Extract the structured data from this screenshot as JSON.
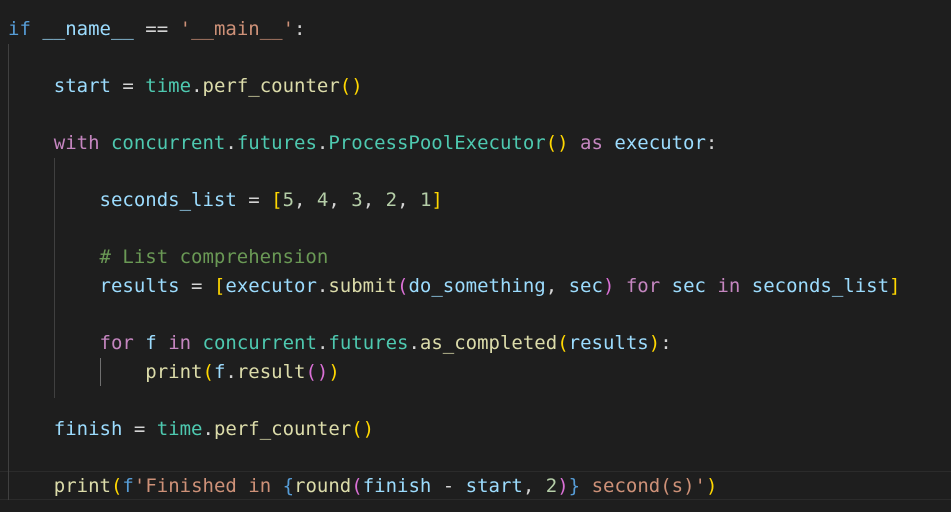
{
  "editor": {
    "language": "python",
    "theme_colors": {
      "background": "#1e1e1e",
      "keyword_control": "#c586c0",
      "keyword_storage": "#569cd6",
      "variable": "#9cdcfe",
      "function": "#dcdcaa",
      "class": "#4ec9b0",
      "string": "#ce9178",
      "number": "#b5cea8",
      "comment": "#6a9955",
      "bracket_level1": "#ffd700",
      "bracket_level2": "#da70d6",
      "bracket_level3": "#179fff",
      "operator": "#d4d4d4"
    },
    "lines": [
      {
        "tokens": [
          {
            "t": "if",
            "c": "keyword_storage"
          },
          {
            "t": " ",
            "c": "operator"
          },
          {
            "t": "__name__",
            "c": "variable"
          },
          {
            "t": " == ",
            "c": "operator"
          },
          {
            "t": "'__main__'",
            "c": "string"
          },
          {
            "t": ":",
            "c": "operator"
          }
        ]
      },
      {
        "tokens": []
      },
      {
        "tokens": [
          {
            "t": "    ",
            "c": "operator"
          },
          {
            "t": "start",
            "c": "variable"
          },
          {
            "t": " = ",
            "c": "operator"
          },
          {
            "t": "time",
            "c": "class"
          },
          {
            "t": ".",
            "c": "operator"
          },
          {
            "t": "perf_counter",
            "c": "function"
          },
          {
            "t": "()",
            "c": "bracket_level1"
          }
        ]
      },
      {
        "tokens": []
      },
      {
        "tokens": [
          {
            "t": "    ",
            "c": "operator"
          },
          {
            "t": "with",
            "c": "keyword_control"
          },
          {
            "t": " ",
            "c": "operator"
          },
          {
            "t": "concurrent",
            "c": "class"
          },
          {
            "t": ".",
            "c": "operator"
          },
          {
            "t": "futures",
            "c": "class"
          },
          {
            "t": ".",
            "c": "operator"
          },
          {
            "t": "ProcessPoolExecutor",
            "c": "class"
          },
          {
            "t": "()",
            "c": "bracket_level1"
          },
          {
            "t": " ",
            "c": "operator"
          },
          {
            "t": "as",
            "c": "keyword_control"
          },
          {
            "t": " ",
            "c": "operator"
          },
          {
            "t": "executor",
            "c": "variable"
          },
          {
            "t": ":",
            "c": "operator"
          }
        ]
      },
      {
        "tokens": []
      },
      {
        "tokens": [
          {
            "t": "        ",
            "c": "operator"
          },
          {
            "t": "seconds_list",
            "c": "variable"
          },
          {
            "t": " = ",
            "c": "operator"
          },
          {
            "t": "[",
            "c": "bracket_level1"
          },
          {
            "t": "5",
            "c": "number"
          },
          {
            "t": ", ",
            "c": "operator"
          },
          {
            "t": "4",
            "c": "number"
          },
          {
            "t": ", ",
            "c": "operator"
          },
          {
            "t": "3",
            "c": "number"
          },
          {
            "t": ", ",
            "c": "operator"
          },
          {
            "t": "2",
            "c": "number"
          },
          {
            "t": ", ",
            "c": "operator"
          },
          {
            "t": "1",
            "c": "number"
          },
          {
            "t": "]",
            "c": "bracket_level1"
          }
        ]
      },
      {
        "tokens": []
      },
      {
        "tokens": [
          {
            "t": "        ",
            "c": "operator"
          },
          {
            "t": "# List comprehension",
            "c": "comment"
          }
        ]
      },
      {
        "tokens": [
          {
            "t": "        ",
            "c": "operator"
          },
          {
            "t": "results",
            "c": "variable"
          },
          {
            "t": " = ",
            "c": "operator"
          },
          {
            "t": "[",
            "c": "bracket_level1"
          },
          {
            "t": "executor",
            "c": "variable"
          },
          {
            "t": ".",
            "c": "operator"
          },
          {
            "t": "submit",
            "c": "function"
          },
          {
            "t": "(",
            "c": "bracket_level2"
          },
          {
            "t": "do_something",
            "c": "variable"
          },
          {
            "t": ", ",
            "c": "operator"
          },
          {
            "t": "sec",
            "c": "variable"
          },
          {
            "t": ")",
            "c": "bracket_level2"
          },
          {
            "t": " ",
            "c": "operator"
          },
          {
            "t": "for",
            "c": "keyword_control"
          },
          {
            "t": " ",
            "c": "operator"
          },
          {
            "t": "sec",
            "c": "variable"
          },
          {
            "t": " ",
            "c": "operator"
          },
          {
            "t": "in",
            "c": "keyword_control"
          },
          {
            "t": " ",
            "c": "operator"
          },
          {
            "t": "seconds_list",
            "c": "variable"
          },
          {
            "t": "]",
            "c": "bracket_level1"
          }
        ]
      },
      {
        "tokens": []
      },
      {
        "tokens": [
          {
            "t": "        ",
            "c": "operator"
          },
          {
            "t": "for",
            "c": "keyword_control"
          },
          {
            "t": " ",
            "c": "operator"
          },
          {
            "t": "f",
            "c": "variable"
          },
          {
            "t": " ",
            "c": "operator"
          },
          {
            "t": "in",
            "c": "keyword_control"
          },
          {
            "t": " ",
            "c": "operator"
          },
          {
            "t": "concurrent",
            "c": "class"
          },
          {
            "t": ".",
            "c": "operator"
          },
          {
            "t": "futures",
            "c": "class"
          },
          {
            "t": ".",
            "c": "operator"
          },
          {
            "t": "as_completed",
            "c": "function"
          },
          {
            "t": "(",
            "c": "bracket_level1"
          },
          {
            "t": "results",
            "c": "variable"
          },
          {
            "t": ")",
            "c": "bracket_level1"
          },
          {
            "t": ":",
            "c": "operator"
          }
        ]
      },
      {
        "tokens": [
          {
            "t": "            ",
            "c": "operator"
          },
          {
            "t": "print",
            "c": "function"
          },
          {
            "t": "(",
            "c": "bracket_level1"
          },
          {
            "t": "f",
            "c": "variable"
          },
          {
            "t": ".",
            "c": "operator"
          },
          {
            "t": "result",
            "c": "function"
          },
          {
            "t": "()",
            "c": "bracket_level2"
          },
          {
            "t": ")",
            "c": "bracket_level1"
          }
        ]
      },
      {
        "tokens": []
      },
      {
        "tokens": [
          {
            "t": "    ",
            "c": "operator"
          },
          {
            "t": "finish",
            "c": "variable"
          },
          {
            "t": " = ",
            "c": "operator"
          },
          {
            "t": "time",
            "c": "class"
          },
          {
            "t": ".",
            "c": "operator"
          },
          {
            "t": "perf_counter",
            "c": "function"
          },
          {
            "t": "()",
            "c": "bracket_level1"
          }
        ]
      },
      {
        "tokens": []
      },
      {
        "tokens": [
          {
            "t": "    ",
            "c": "operator"
          },
          {
            "t": "print",
            "c": "function"
          },
          {
            "t": "(",
            "c": "bracket_level1"
          },
          {
            "t": "f",
            "c": "keyword_storage"
          },
          {
            "t": "'Finished in ",
            "c": "string"
          },
          {
            "t": "{",
            "c": "keyword_storage"
          },
          {
            "t": "round",
            "c": "function"
          },
          {
            "t": "(",
            "c": "bracket_level2"
          },
          {
            "t": "finish",
            "c": "variable"
          },
          {
            "t": " - ",
            "c": "operator"
          },
          {
            "t": "start",
            "c": "variable"
          },
          {
            "t": ", ",
            "c": "operator"
          },
          {
            "t": "2",
            "c": "number"
          },
          {
            "t": ")",
            "c": "bracket_level2"
          },
          {
            "t": "}",
            "c": "keyword_storage"
          },
          {
            "t": " second(s)'",
            "c": "string"
          },
          {
            "t": ")",
            "c": "bracket_level1"
          }
        ]
      }
    ]
  }
}
